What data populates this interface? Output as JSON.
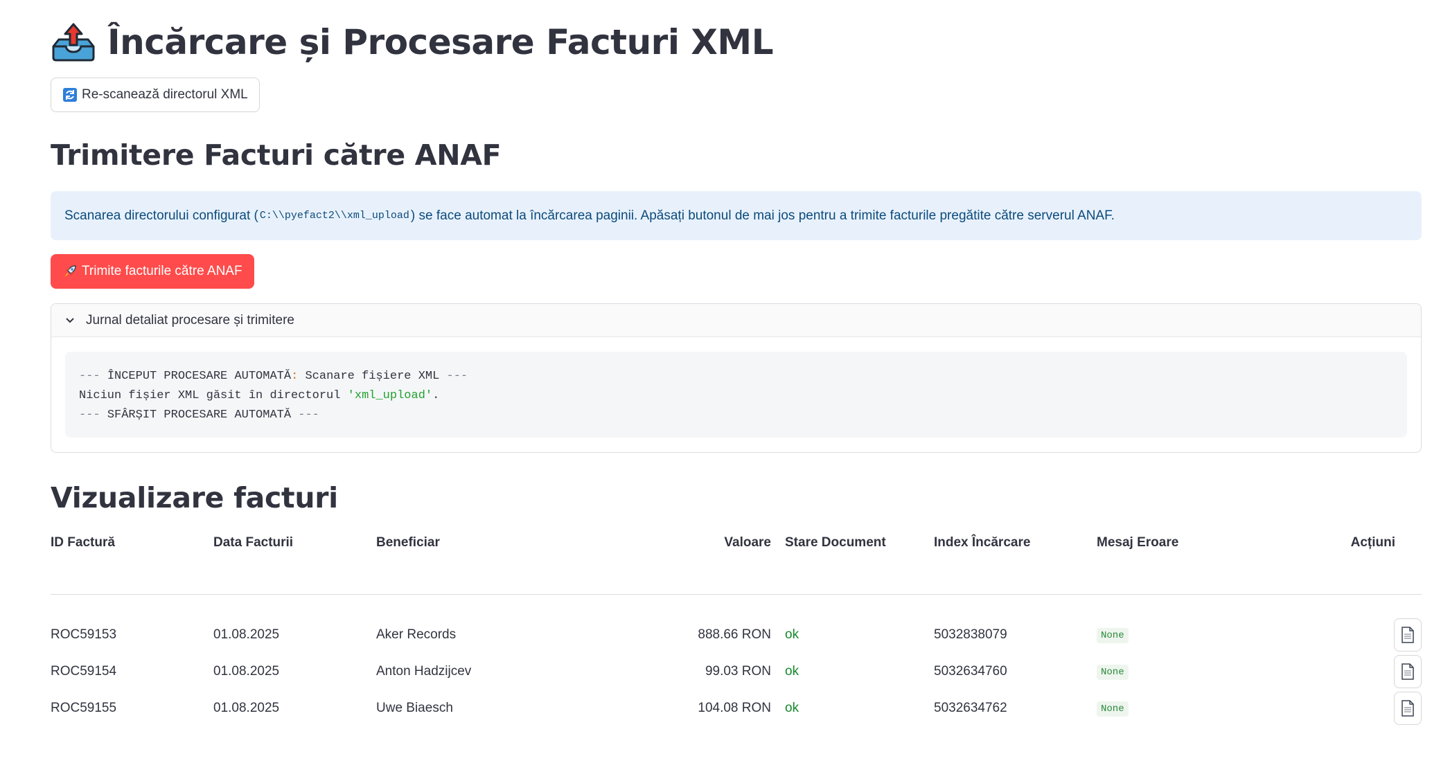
{
  "header": {
    "title": "Încărcare și Procesare Facturi XML",
    "icon": "outbox-tray-icon"
  },
  "rescan_button": {
    "icon": "refresh-icon",
    "label": "Re-scanează directorul XML"
  },
  "send_section": {
    "heading": "Trimitere Facturi către ANAF",
    "info_before": "Scanarea directorului configurat (",
    "info_path": "C:\\\\pyefact2\\\\xml_upload",
    "info_after": ") se face automat la încărcarea paginii. Apăsați butonul de mai jos pentru a trimite facturile pregătite către serverul ANAF.",
    "send_button": {
      "icon": "rocket-icon",
      "label": "Trimite facturile către ANAF"
    }
  },
  "log_expander": {
    "label": "Jurnal detaliat procesare și trimitere",
    "lines": {
      "l1_dim_prefix": "--- ",
      "l1_text": "ÎNCEPUT PROCESARE AUTOMATĂ",
      "l1_colon": ":",
      "l1_rest": " Scanare fișiere XML ",
      "l1_dim_suffix": "---",
      "l2_text": "Niciun fișier XML găsit în directorul ",
      "l2_string": "'xml_upload'",
      "l2_end": ".",
      "l3_dim_prefix": "--- ",
      "l3_text": "SFÂRȘIT PROCESARE AUTOMATĂ ",
      "l3_dim_suffix": "---"
    }
  },
  "view_section": {
    "heading": "Vizualizare facturi",
    "columns": [
      "ID Factură",
      "Data Facturii",
      "Beneficiar",
      "Valoare",
      "Stare Document",
      "Index Încărcare",
      "Mesaj Eroare",
      "Acțiuni"
    ],
    "rows": [
      {
        "id": "ROC59153",
        "date": "01.08.2025",
        "beneficiary": "Aker Records",
        "value": "888.66 RON",
        "status": "ok",
        "index": "5032838079",
        "error": "None"
      },
      {
        "id": "ROC59154",
        "date": "01.08.2025",
        "beneficiary": "Anton Hadzijcev",
        "value": "99.03 RON",
        "status": "ok",
        "index": "5032634760",
        "error": "None"
      },
      {
        "id": "ROC59155",
        "date": "01.08.2025",
        "beneficiary": "Uwe Biaesch",
        "value": "104.08 RON",
        "status": "ok",
        "index": "5032634762",
        "error": "None"
      }
    ],
    "action_icon": "document-icon"
  },
  "colors": {
    "primary": "#ff4b4b",
    "info_bg": "#e8f1fb",
    "info_text": "#0b4a7c",
    "status_ok": "#158a2b"
  }
}
